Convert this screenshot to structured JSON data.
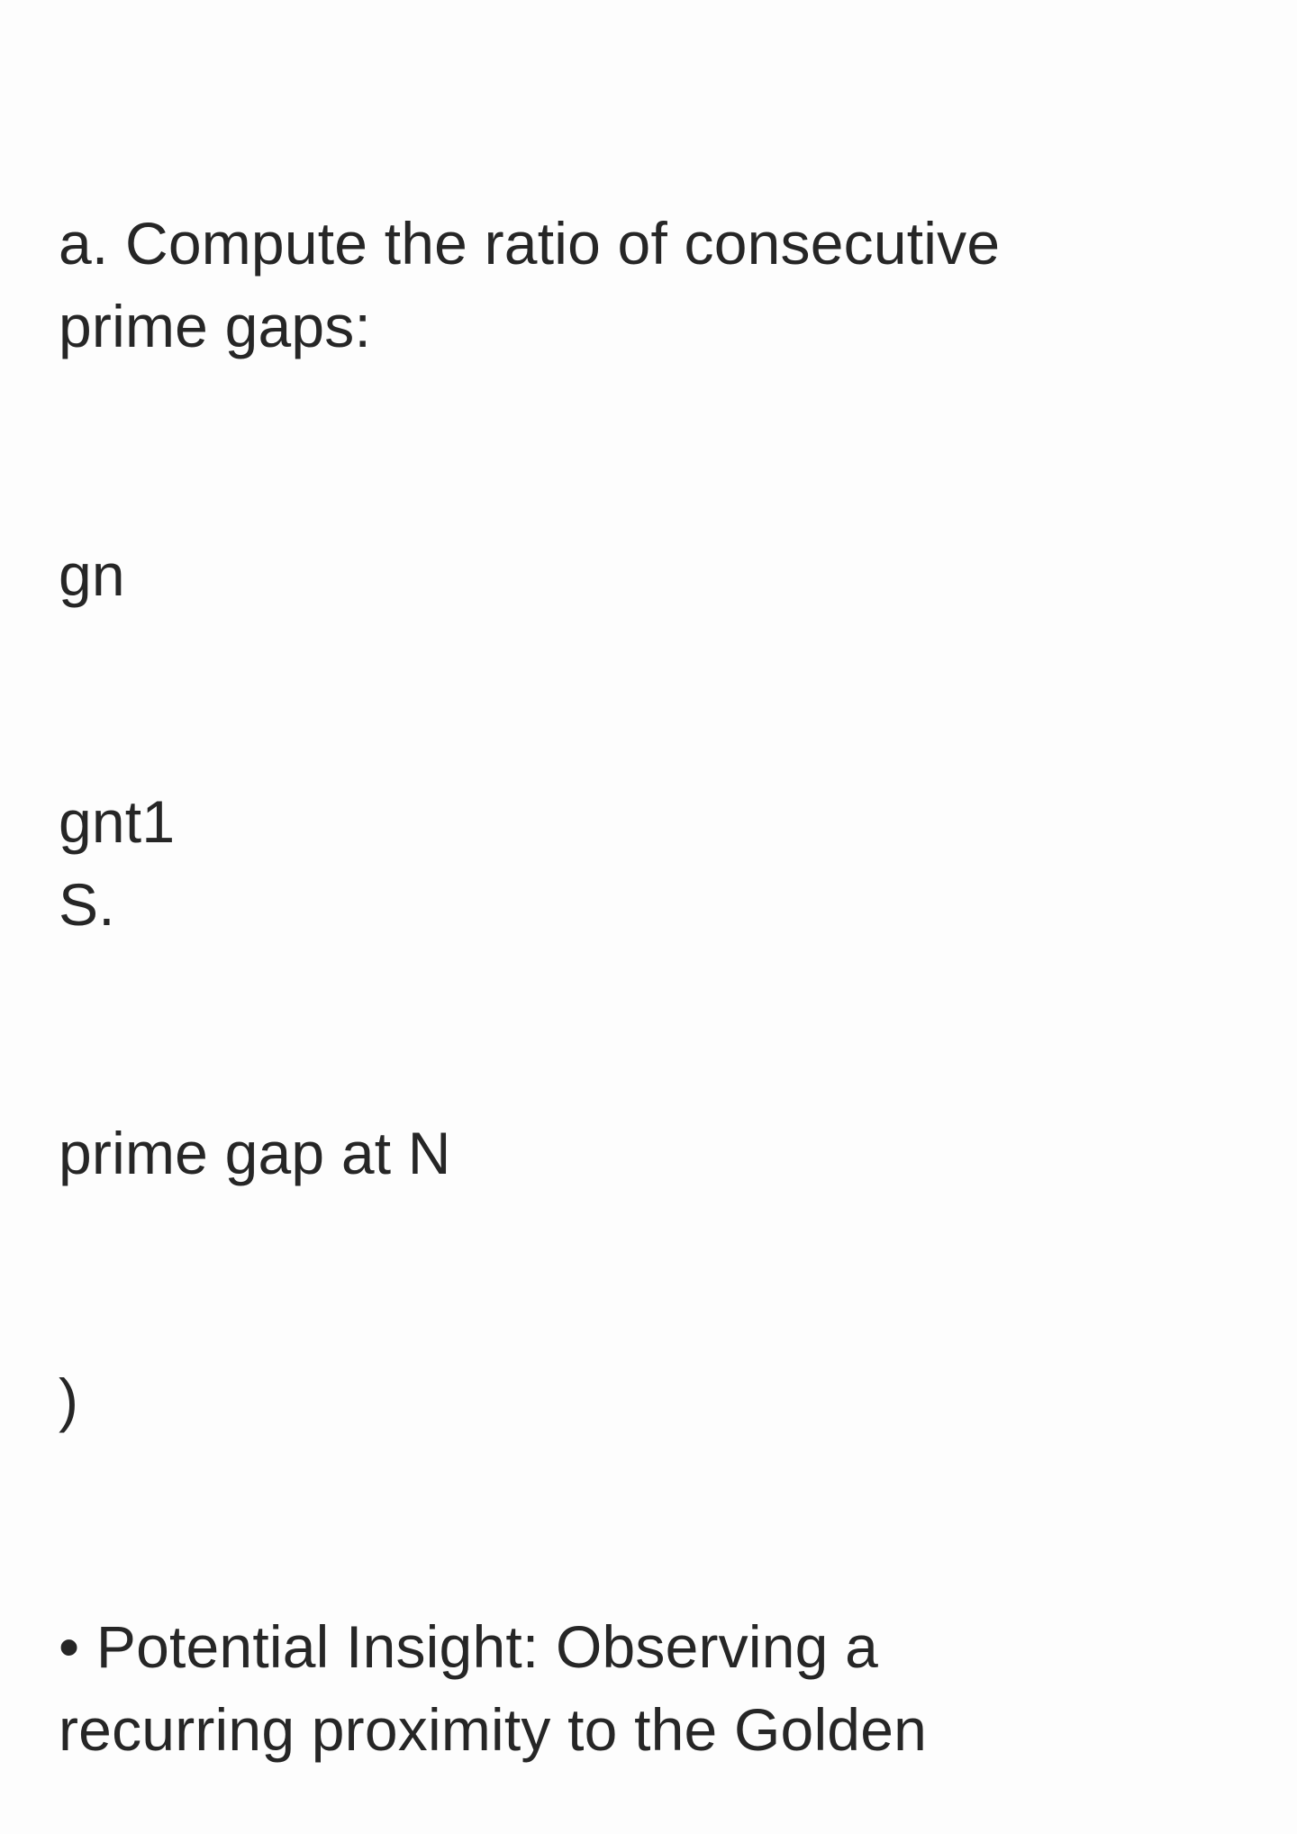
{
  "document": {
    "lines": [
      "a. Compute the ratio of consecutive",
      "prime gaps:",
      "gn",
      "gnt1",
      "S.",
      "prime gap at N",
      ")",
      "• Potential Insight: Observing a",
      "recurring proximity to the Golden"
    ]
  }
}
